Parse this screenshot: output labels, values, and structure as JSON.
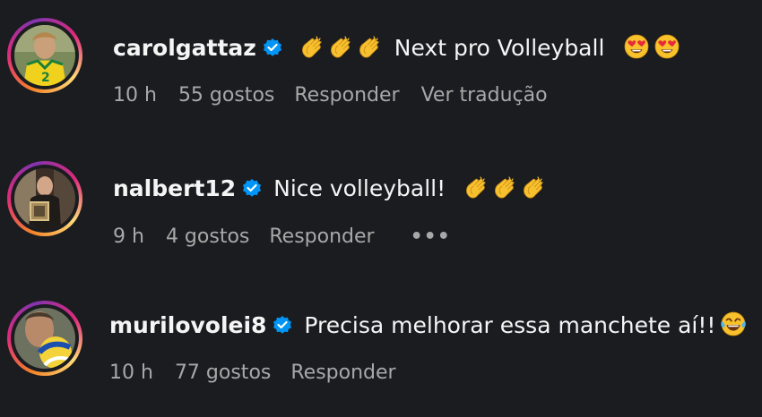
{
  "comments": [
    {
      "username": "carolgattaz",
      "verified": true,
      "text": "Next pro Volleyball",
      "leading_emojis": [
        "clapping-hands",
        "clapping-hands",
        "clapping-hands"
      ],
      "trailing_emojis": [
        "heart-eyes",
        "heart-eyes"
      ],
      "time": "10 h",
      "likes": "55 gostos",
      "reply": "Responder",
      "translate": "Ver tradução"
    },
    {
      "username": "nalbert12",
      "verified": true,
      "text": "Nice volleyball!",
      "trailing_emojis": [
        "clapping-hands",
        "clapping-hands",
        "clapping-hands"
      ],
      "time": "9 h",
      "likes": "4 gostos",
      "reply": "Responder",
      "more": "•••"
    },
    {
      "username": "murilovolei8",
      "verified": true,
      "text": "Precisa melhorar essa manchete aí!!",
      "trailing_emojis": [
        "tears-of-joy"
      ],
      "time": "10 h",
      "likes": "77 gostos",
      "reply": "Responder"
    }
  ],
  "colors": {
    "background": "#1b1c20",
    "text": "#f5f5f5",
    "meta": "#a8a8a8",
    "verified": "#0095f6"
  }
}
